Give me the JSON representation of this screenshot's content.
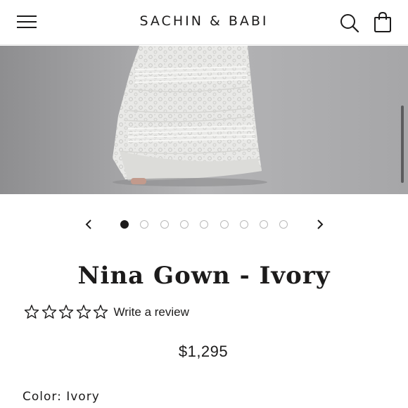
{
  "header": {
    "brand": "SACHIN & BABI",
    "menu_icon": "hamburger-menu-icon",
    "search_icon": "search-icon",
    "cart_icon": "shopping-bag-icon"
  },
  "gallery": {
    "slide_count": 9,
    "active_slide": 1
  },
  "product": {
    "title": "Nina Gown - Ivory",
    "rating_stars": 0,
    "rating_max": 5,
    "review_link": "Write a review",
    "price": "$1,295",
    "color_label": "Color:",
    "color_value": "Ivory"
  },
  "colors": {
    "text": "#1c1b1b",
    "image_background": "#9f9fa1",
    "dot_inactive_border": "#b9b9b9"
  }
}
